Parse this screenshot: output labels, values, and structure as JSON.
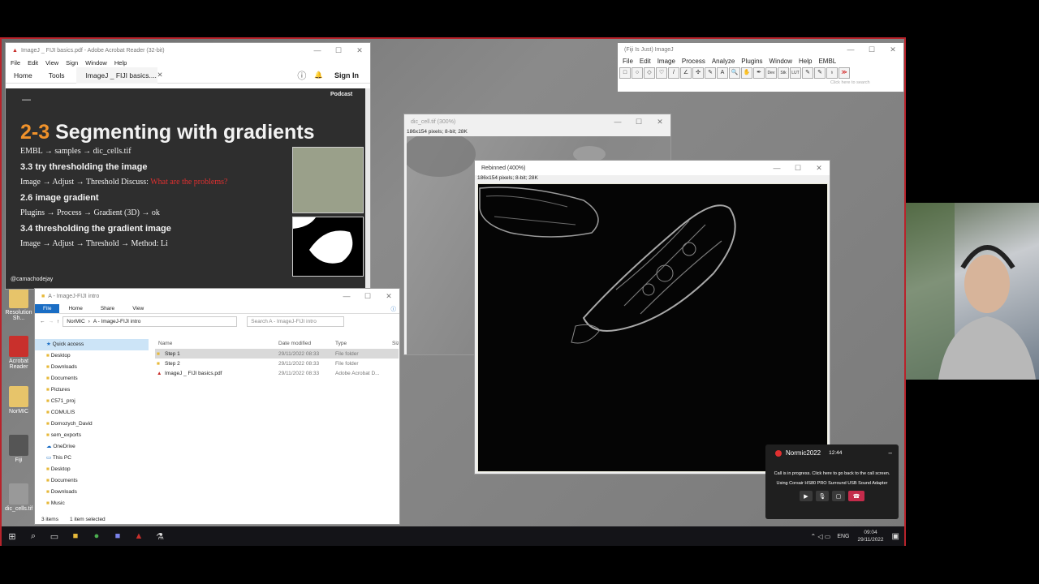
{
  "desktop": {
    "icons": [
      {
        "label": "Resolution Sh..."
      },
      {
        "label": "Acrobat Reader"
      },
      {
        "label": "NorMIC"
      },
      {
        "label": "Fiji"
      },
      {
        "label": "dic_cells.tif"
      }
    ]
  },
  "acrobat": {
    "title": "ImageJ _ FIJI basics.pdf - Adobe Acrobat Reader (32-bit)",
    "menu": [
      "File",
      "Edit",
      "View",
      "Sign",
      "Window",
      "Help"
    ],
    "home": "Home",
    "tools": "Tools",
    "doc_tab": "ImageJ _ FIJI basics....",
    "sign_in": "Sign In",
    "slide": {
      "dash": "—",
      "podcast": "Podcast",
      "title_num": "2-3",
      "title_text": " Segmenting with gradients",
      "l1": "EMBL → samples → dic_cells.tif",
      "h1": "3.3 try thresholding the image",
      "l2": "Image → Adjust → Threshold   Discuss:",
      "l2red": "What are the problems?",
      "h2": "2.6 image gradient",
      "l3": "Plugins → Process → Gradient (3D) → ok",
      "h3": "3.4 thresholding the gradient image",
      "l4": "Image → Adjust → Threshold → Method: Li",
      "handle": "@camachodejay"
    }
  },
  "fiji": {
    "title": "(Fiji Is Just) ImageJ",
    "menu": [
      "File",
      "Edit",
      "Image",
      "Process",
      "Analyze",
      "Plugins",
      "Window",
      "Help",
      "EMBL"
    ],
    "tools": [
      "□",
      "○",
      "◇",
      "♡",
      "/",
      "∠",
      "✣",
      "✎",
      "A",
      "🔍",
      "✋",
      "✒",
      "Dev",
      "Stk",
      "LUT",
      "✎",
      "✎",
      "♁",
      "≫"
    ],
    "search": "Click here to search"
  },
  "dic": {
    "title": "dic_cell.tif (300%)",
    "info": "186x154 pixels; 8-bit; 28K"
  },
  "rebin": {
    "title": "Rebinned (400%)",
    "info": "186x154 pixels; 8-bit; 28K"
  },
  "explorer": {
    "title": "A - ImageJ-FIJI intro",
    "ribbon": [
      "File",
      "Home",
      "Share",
      "View"
    ],
    "path": [
      "NorMIC",
      "A - ImageJ-FIJI intro"
    ],
    "search": "Search A - ImageJ-FIJI intro",
    "nav": [
      {
        "label": "Quick access"
      },
      {
        "label": "Desktop"
      },
      {
        "label": "Downloads"
      },
      {
        "label": "Documents"
      },
      {
        "label": "Pictures"
      },
      {
        "label": "C571_proj"
      },
      {
        "label": "COMULIS"
      },
      {
        "label": "Domozych_David"
      },
      {
        "label": "sem_exports"
      },
      {
        "label": "OneDrive"
      },
      {
        "label": "This PC"
      },
      {
        "label": "Desktop"
      },
      {
        "label": "Documents"
      },
      {
        "label": "Downloads"
      },
      {
        "label": "Music"
      }
    ],
    "cols": {
      "name": "Name",
      "date": "Date modified",
      "type": "Type",
      "size": "Siz"
    },
    "files": [
      {
        "name": "Step 1",
        "date": "29/11/2022 08:33",
        "type": "File folder"
      },
      {
        "name": "Step 2",
        "date": "29/11/2022 08:33",
        "type": "File folder"
      },
      {
        "name": "ImageJ _ FIJI basics.pdf",
        "date": "29/11/2022 08:33",
        "type": "Adobe Acrobat D..."
      }
    ],
    "status_items": "3 items",
    "status_sel": "1 item selected"
  },
  "call": {
    "name": "Normic2022",
    "time": "12:44",
    "msg": "Call is in progress. Click here to go back to the call screen.",
    "device": "Using Corsair HS80 PRO Surround USB Sound Adapter"
  },
  "taskbar": {
    "lang": "ENG",
    "time": "09:04",
    "date": "29/11/2022"
  },
  "colors": {
    "accent": "#f0922b",
    "frame": "#b8232b",
    "red_text": "#e03030",
    "hangup": "#c42b4b"
  }
}
